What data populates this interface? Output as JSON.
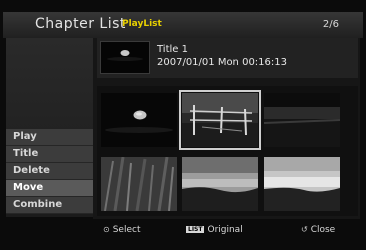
{
  "header": {
    "title": "Chapter List",
    "subtitle": "PlayList",
    "page_indicator": "2/6"
  },
  "info": {
    "title_line": "Title 1",
    "date_line": "2007/01/01  Mon  00:16:13"
  },
  "menu": {
    "items": [
      {
        "label": "Play"
      },
      {
        "label": "Title"
      },
      {
        "label": "Delete"
      },
      {
        "label": "Move"
      },
      {
        "label": "Combine"
      }
    ],
    "active_label": "Move"
  },
  "thumbnails": [
    {
      "scene": "dark-oval",
      "selected": false
    },
    {
      "scene": "fence",
      "selected": true
    },
    {
      "scene": "dark-landscape",
      "selected": false
    },
    {
      "scene": "grass",
      "selected": false
    },
    {
      "scene": "sky-field",
      "selected": false
    },
    {
      "scene": "sky-field-light",
      "selected": false
    }
  ],
  "footer": {
    "select": {
      "icon": "enter-icon",
      "label": "Select"
    },
    "original": {
      "badge": "LIST",
      "label": "Original"
    },
    "close": {
      "icon": "return-icon",
      "label": "Close"
    }
  },
  "colors": {
    "subtitle": "#e8d000",
    "menu_bg": "#3c3c3c",
    "menu_active": "#5a5a5a",
    "selection": "#cfcfcf"
  }
}
